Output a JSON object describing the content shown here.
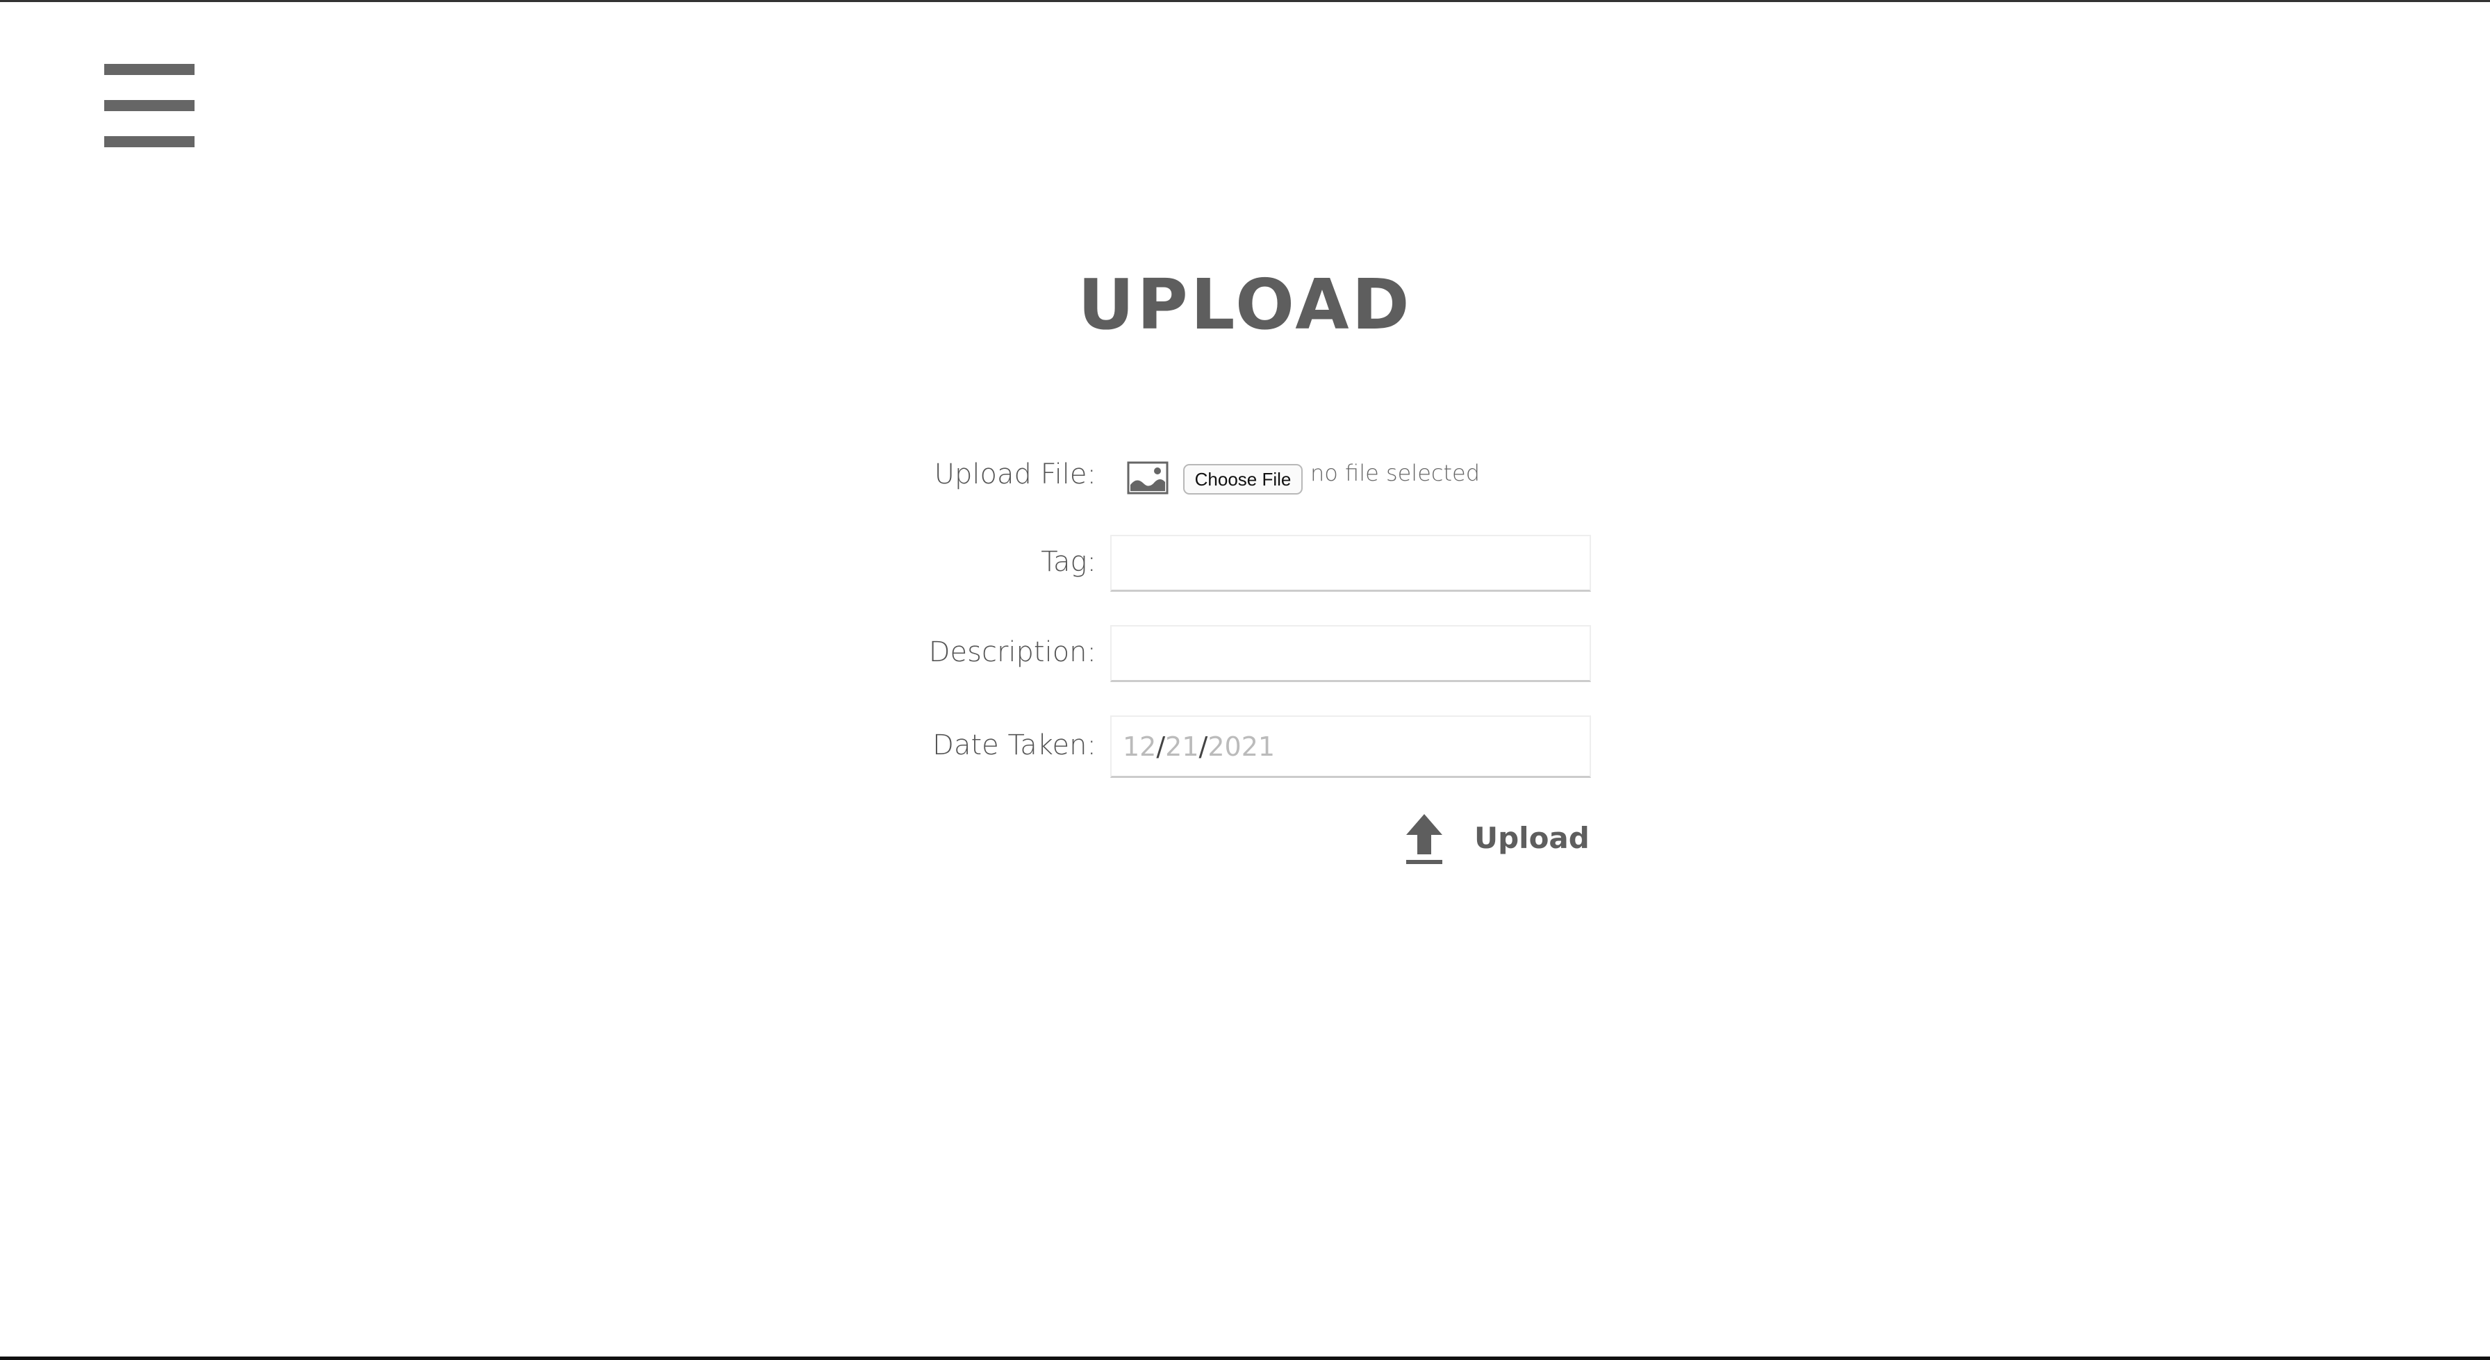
{
  "header": {
    "menu_icon": "hamburger-menu-icon"
  },
  "page": {
    "title": "UPLOAD"
  },
  "form": {
    "file": {
      "label": "Upload File:",
      "icon": "image-icon",
      "button_label": "Choose File",
      "status": "no file selected"
    },
    "tag": {
      "label": "Tag:",
      "value": ""
    },
    "description": {
      "label": "Description:",
      "value": ""
    },
    "date_taken": {
      "label": "Date Taken:",
      "month": "12",
      "day": "21",
      "year": "2021",
      "separator": "/"
    },
    "submit": {
      "label": "Upload",
      "icon": "upload-arrow-icon"
    }
  },
  "colors": {
    "text": "#666666",
    "title": "#5e5e5e",
    "placeholder": "#bbbbbb",
    "field_border": "#cccccc"
  }
}
